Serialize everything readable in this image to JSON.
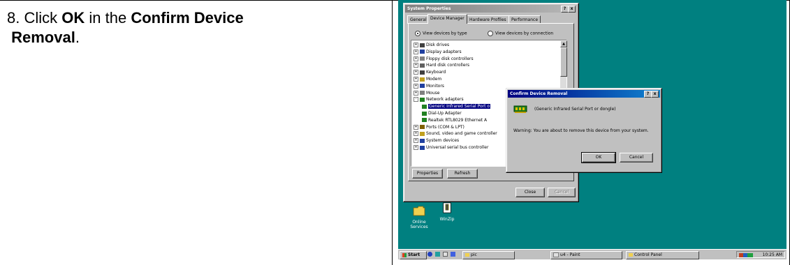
{
  "instruction": {
    "step_number": "8.",
    "part1": "Click",
    "bold1": "OK",
    "part2": "in the",
    "bold2": "Confirm Device",
    "bold3": "Removal",
    "part3": "."
  },
  "system_properties": {
    "title": "System Properties",
    "title_buttons": [
      "?",
      "x"
    ],
    "tabs": [
      "General",
      "Device Manager",
      "Hardware Profiles",
      "Performance"
    ],
    "selected_tab": "Device Manager",
    "view_by_type": "View devices by type",
    "view_by_connection": "View devices by connection",
    "tree": [
      {
        "exp": "+",
        "label": "Disk drives",
        "indent": 0
      },
      {
        "exp": "+",
        "label": "Display adapters",
        "indent": 0
      },
      {
        "exp": "+",
        "label": "Floppy disk controllers",
        "indent": 0
      },
      {
        "exp": "+",
        "label": "Hard disk controllers",
        "indent": 0
      },
      {
        "exp": "+",
        "label": "Keyboard",
        "indent": 0
      },
      {
        "exp": "+",
        "label": "Modem",
        "indent": 0
      },
      {
        "exp": "+",
        "label": "Monitors",
        "indent": 0
      },
      {
        "exp": "+",
        "label": "Mouse",
        "indent": 0
      },
      {
        "exp": "-",
        "label": "Network adapters",
        "indent": 0
      },
      {
        "exp": "",
        "label": "Generic Infrared Serial Port o",
        "indent": 1,
        "selected": true
      },
      {
        "exp": "",
        "label": "Dial-Up Adapter",
        "indent": 1
      },
      {
        "exp": "",
        "label": "Realtek RTL8029 Ethernet A",
        "indent": 1
      },
      {
        "exp": "+",
        "label": "Ports (COM & LPT)",
        "indent": 0
      },
      {
        "exp": "+",
        "label": "Sound, video and game controller",
        "indent": 0
      },
      {
        "exp": "+",
        "label": "System devices",
        "indent": 0
      },
      {
        "exp": "+",
        "label": "Universal serial bus controller",
        "indent": 0
      }
    ],
    "properties_button": "Properties",
    "refresh_button": "Refresh",
    "close_button": "Close",
    "cancel_button": "Cancel"
  },
  "confirm_dialog": {
    "title": "Confirm Device Removal",
    "title_buttons": [
      "?",
      "x"
    ],
    "device_name": "Generic Infrared Serial Port or dongle",
    "warning": "Warning: You are about to remove this device from your system.",
    "ok_button": "OK",
    "cancel_button": "Cancel"
  },
  "desktop": {
    "icons": [
      {
        "label1": "Online",
        "label2": "Services"
      },
      {
        "label1": "WinZip",
        "label2": ""
      }
    ]
  },
  "taskbar": {
    "start": "Start",
    "tasks": [
      "pic",
      "u4 - Paint",
      "Control Panel"
    ],
    "clock": "10:25 AM"
  },
  "colors": {
    "desktop": "#008080",
    "active_title": "#000080",
    "window_face": "#c0c0c0"
  }
}
